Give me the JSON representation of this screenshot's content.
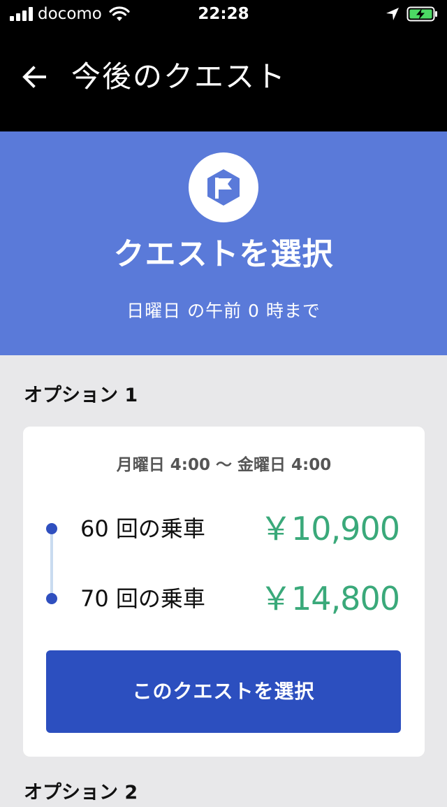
{
  "status_bar": {
    "carrier": "docomo",
    "time": "22:28",
    "icons": [
      "signal-icon",
      "wifi-icon",
      "location-arrow-icon",
      "battery-charging-icon"
    ],
    "battery_color": "#4cd964"
  },
  "header": {
    "title": "今後のクエスト",
    "back_icon": "arrow-left-icon"
  },
  "hero": {
    "badge_icon": "flag-hexagon-icon",
    "title": "クエストを選択",
    "deadline": "日曜日 の午前 0 時まで",
    "background_color": "#5a7ad9"
  },
  "options": [
    {
      "heading": "オプション 1",
      "period": "月曜日 4:00 〜 金曜日 4:00",
      "tiers": [
        {
          "label": "60 回の乗車",
          "reward": "￥10,900"
        },
        {
          "label": "70 回の乗車",
          "reward": "￥14,800"
        }
      ],
      "select_label": "このクエストを選択"
    },
    {
      "heading": "オプション 2"
    }
  ],
  "colors": {
    "accent": "#2c4fbf",
    "reward": "#3aa97a",
    "page_background": "#e8e8ea"
  }
}
